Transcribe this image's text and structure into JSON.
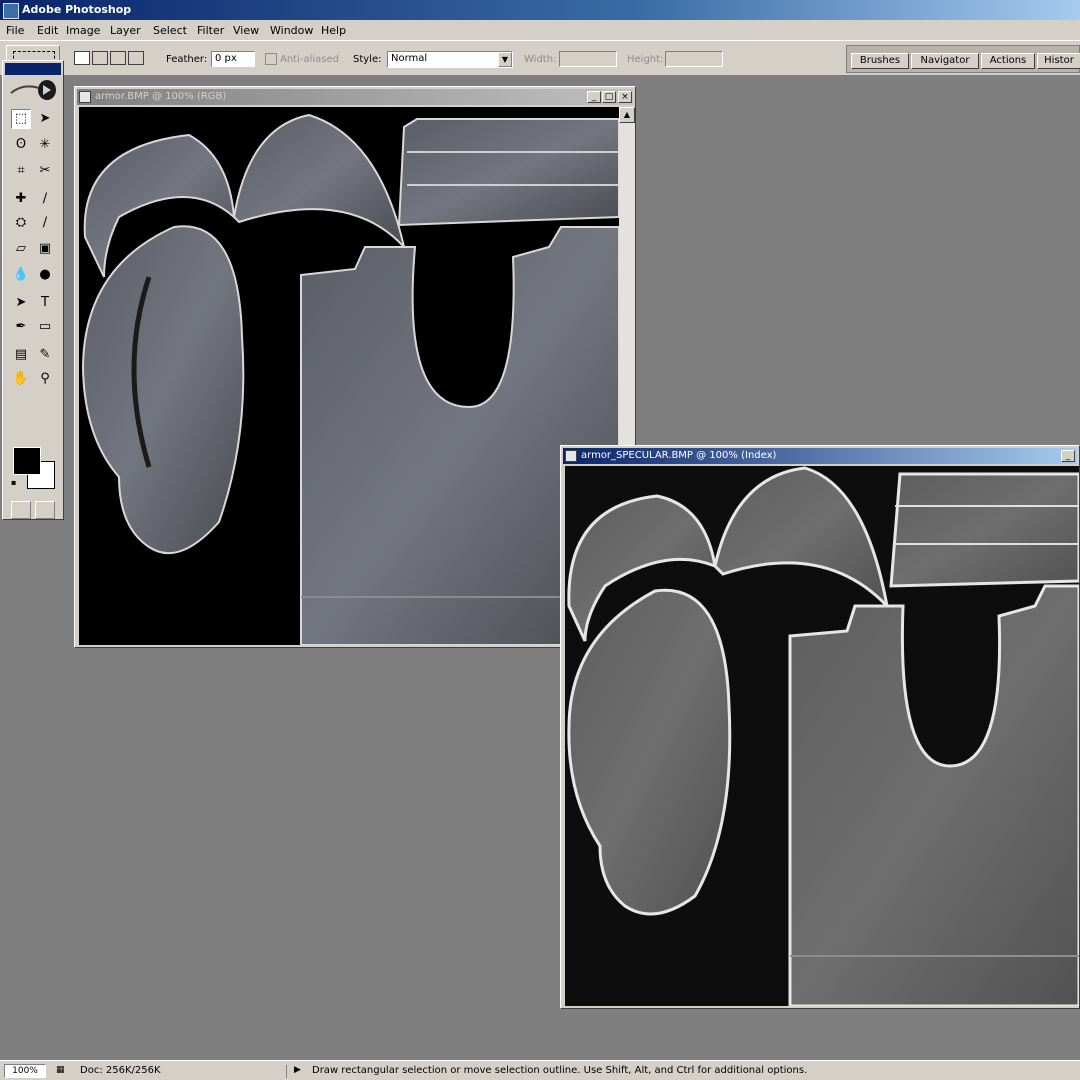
{
  "app": {
    "title": "Adobe Photoshop"
  },
  "menu": [
    "File",
    "Edit",
    "Image",
    "Layer",
    "Select",
    "Filter",
    "View",
    "Window",
    "Help"
  ],
  "options": {
    "feather_label": "Feather:",
    "feather_value": "0 px",
    "antialiased_label": "Anti-aliased",
    "style_label": "Style:",
    "style_value": "Normal",
    "width_label": "Width:",
    "height_label": "Height:"
  },
  "palette_tabs": [
    "Brushes",
    "Navigator",
    "Actions",
    "Histor"
  ],
  "tools": {
    "icons": [
      "marquee-icon",
      "move-icon",
      "lasso-icon",
      "magic-wand-icon",
      "crop-icon",
      "slice-icon",
      "healing-brush-icon",
      "brush-icon",
      "clone-stamp-icon",
      "history-brush-icon",
      "eraser-icon",
      "gradient-icon",
      "blur-icon",
      "dodge-icon",
      "path-selection-icon",
      "type-icon",
      "pen-icon",
      "shape-icon",
      "notes-icon",
      "eyedropper-icon",
      "hand-icon",
      "zoom-icon"
    ],
    "glyphs": [
      "⬚",
      "➤",
      "ʘ",
      "✳",
      "⌗",
      "✂",
      "✚",
      "∕",
      "⛭",
      "∕",
      "▱",
      "▣",
      "💧",
      "●",
      "➤",
      "T",
      "✒",
      "▭",
      "▤",
      "✎",
      "✋",
      "⚲"
    ]
  },
  "documents": [
    {
      "title": "armor.BMP @ 100% (RGB)",
      "state": "inactive"
    },
    {
      "title": "armor_SPECULAR.BMP @ 100% (Index)",
      "state": "active"
    }
  ],
  "status": {
    "zoom": "100%",
    "doc_size": "Doc: 256K/256K",
    "hint": "Draw rectangular selection or move selection outline. Use Shift, Alt, and Ctrl for additional options."
  }
}
